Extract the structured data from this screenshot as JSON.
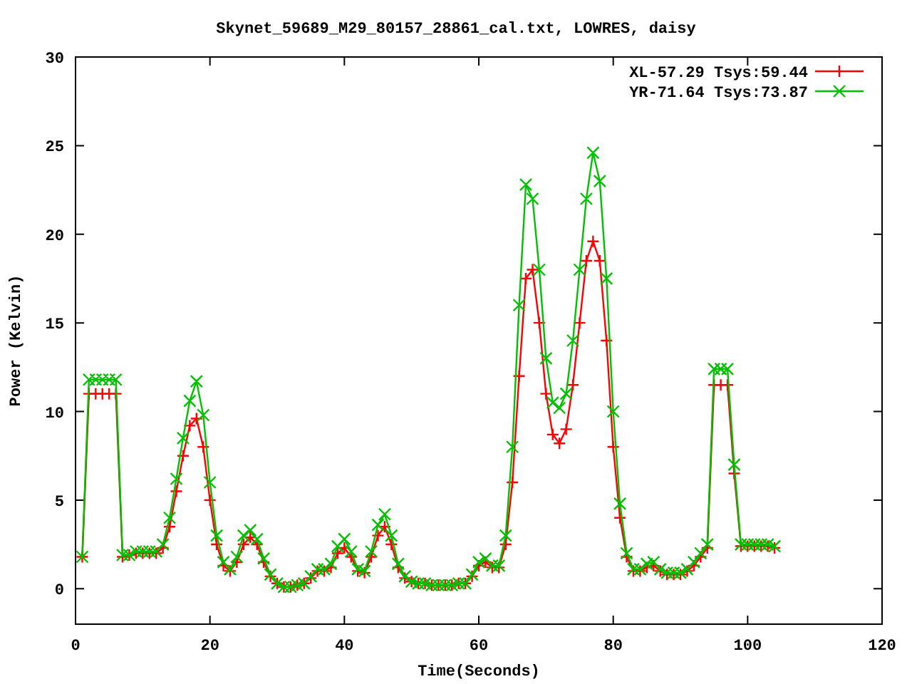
{
  "chart_data": {
    "type": "line",
    "title": "Skynet_59689_M29_80157_28861_cal.txt, LOWRES, daisy",
    "xlabel": "Time(Seconds)",
    "ylabel": "Power (Kelvin)",
    "xlim": [
      0,
      120
    ],
    "ylim": [
      -2,
      30
    ],
    "xticks": [
      0,
      20,
      40,
      60,
      80,
      100,
      120
    ],
    "yticks": [
      0,
      5,
      10,
      15,
      20,
      25,
      30
    ],
    "legend": true,
    "x": [
      1,
      2,
      3,
      4,
      5,
      6,
      7,
      8,
      9,
      10,
      11,
      12,
      13,
      14,
      15,
      16,
      17,
      18,
      19,
      20,
      21,
      22,
      23,
      24,
      25,
      26,
      27,
      28,
      29,
      30,
      31,
      32,
      33,
      34,
      35,
      36,
      37,
      38,
      39,
      40,
      41,
      42,
      43,
      44,
      45,
      46,
      47,
      48,
      49,
      50,
      51,
      52,
      53,
      54,
      55,
      56,
      57,
      58,
      59,
      60,
      61,
      62,
      63,
      64,
      65,
      66,
      67,
      68,
      69,
      70,
      71,
      72,
      73,
      74,
      75,
      76,
      77,
      78,
      79,
      80,
      81,
      82,
      83,
      84,
      85,
      86,
      87,
      88,
      89,
      90,
      91,
      92,
      93,
      94,
      95,
      96,
      97,
      98,
      99,
      100,
      101,
      102,
      103,
      104
    ],
    "series": [
      {
        "name": "XL-57.29 Tsys:59.44",
        "color": "#ff0000",
        "marker": "plus",
        "values": [
          1.8,
          11,
          11,
          11,
          11,
          11,
          1.8,
          1.9,
          2,
          2,
          2,
          2,
          2.3,
          3.5,
          5.5,
          7.5,
          9.2,
          9.6,
          8,
          5,
          2.5,
          1.3,
          1,
          1.5,
          2.5,
          2.9,
          2.5,
          1.5,
          0.7,
          0.3,
          0.1,
          0.1,
          0.2,
          0.3,
          0.6,
          1,
          1,
          1.2,
          2,
          2.3,
          1.8,
          1,
          0.9,
          1.8,
          3,
          3.5,
          2.5,
          1.2,
          0.6,
          0.4,
          0.3,
          0.3,
          0.2,
          0.2,
          0.2,
          0.2,
          0.3,
          0.3,
          0.7,
          1.3,
          1.5,
          1.2,
          1.2,
          2.5,
          6,
          12,
          17.5,
          18,
          15,
          11,
          8.7,
          8.2,
          9,
          11.5,
          15,
          18.5,
          19.6,
          18.5,
          14,
          8,
          4,
          1.8,
          1,
          1,
          1.2,
          1.3,
          1,
          0.8,
          0.8,
          0.8,
          1,
          1.3,
          1.8,
          2.3,
          11.5,
          11.5,
          11.5,
          6.5,
          2.4,
          2.4,
          2.4,
          2.4,
          2.4,
          2.3
        ]
      },
      {
        "name": "YR-71.64 Tsys:73.87",
        "color": "#00c000",
        "marker": "cross",
        "values": [
          1.8,
          11.8,
          11.8,
          11.8,
          11.8,
          11.8,
          1.9,
          1.9,
          2.1,
          2.1,
          2.1,
          2.1,
          2.5,
          4,
          6.2,
          8.5,
          10.6,
          11.7,
          9.8,
          6,
          3,
          1.5,
          1.1,
          1.8,
          3,
          3.3,
          2.8,
          1.7,
          0.8,
          0.3,
          0.1,
          0.1,
          0.2,
          0.3,
          0.7,
          1.1,
          1.1,
          1.4,
          2.4,
          2.8,
          2.1,
          1.1,
          1,
          2.1,
          3.6,
          4.2,
          3,
          1.4,
          0.7,
          0.4,
          0.3,
          0.3,
          0.2,
          0.2,
          0.2,
          0.2,
          0.3,
          0.3,
          0.8,
          1.5,
          1.7,
          1.3,
          1.3,
          3,
          8,
          16,
          22.8,
          22,
          18,
          13,
          10.5,
          10.2,
          11,
          14,
          18,
          22,
          24.6,
          23,
          17.5,
          10,
          4.8,
          2,
          1.1,
          1.1,
          1.4,
          1.5,
          1.1,
          0.9,
          0.9,
          0.9,
          1.1,
          1.5,
          2,
          2.5,
          12.4,
          12.4,
          12.4,
          7,
          2.5,
          2.5,
          2.5,
          2.5,
          2.5,
          2.4
        ]
      }
    ]
  }
}
